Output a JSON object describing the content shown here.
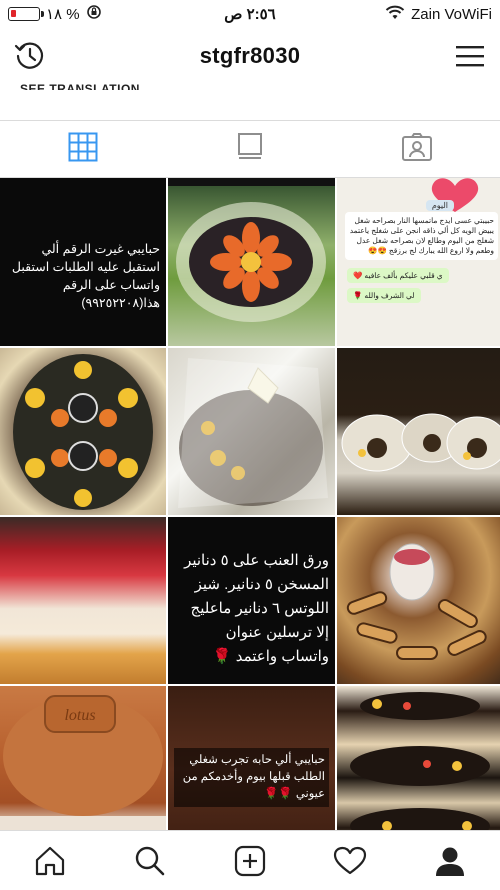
{
  "status_bar": {
    "battery_percent": "١٨ %",
    "battery_level": 0.18,
    "time": "٢:٥٦ ص",
    "carrier": "Zain VoWiFi",
    "icons": [
      "battery-icon",
      "rotation-lock-icon",
      "wifi-icon"
    ]
  },
  "header": {
    "username": "stgfr8030",
    "left_icon": "history-icon",
    "right_icon": "menu-icon"
  },
  "bio": {
    "see_translation": "SEE TRANSLATION"
  },
  "tabs": {
    "items": [
      {
        "icon": "grid-icon",
        "active": true
      },
      {
        "icon": "feed-icon",
        "active": false
      },
      {
        "icon": "tagged-icon",
        "active": false
      }
    ],
    "active_color": "#3897f0"
  },
  "grid": {
    "captions": {
      "c0": "حبايبي غيرت الرقم ألي استقبل عليه الطلبات استقبل واتساب على الرقم هذا(٩٩٢٥٢٢٠٨)",
      "chat_header": "اليوم",
      "chat_msg": "حبيبتي عسى ايدج ماتمسها النار بصراحه شغل يبيض الويه كل ألي ذاقه انجن على شغلج ياعتمد شغلج من اليوم وطالع لان بصراحه شغل عدل وطعم ولا اروع الله يبارك لج برزقج 😍😍",
      "chat_reply1": "ي قلبي عليكم بألف عافيه ❤️",
      "chat_reply2": "لي الشرف والله 🌹",
      "c7": "ورق العنب على ٥ دنانير المسخن ٥ دنانير. شيز اللوتس ٦ دنانير ماعليج إلا ترسلين عنوان واتساب واعتمد 🌹",
      "c10": "حبايبي ألي حابه تجرب شغلي الطلب قبلها بيوم وأخدمكم من عيوني 🌹🌹",
      "lotus_text": "lotus"
    }
  },
  "bottom_nav": {
    "items": [
      "home-icon",
      "search-icon",
      "add-post-icon",
      "activity-icon",
      "profile-icon"
    ]
  }
}
